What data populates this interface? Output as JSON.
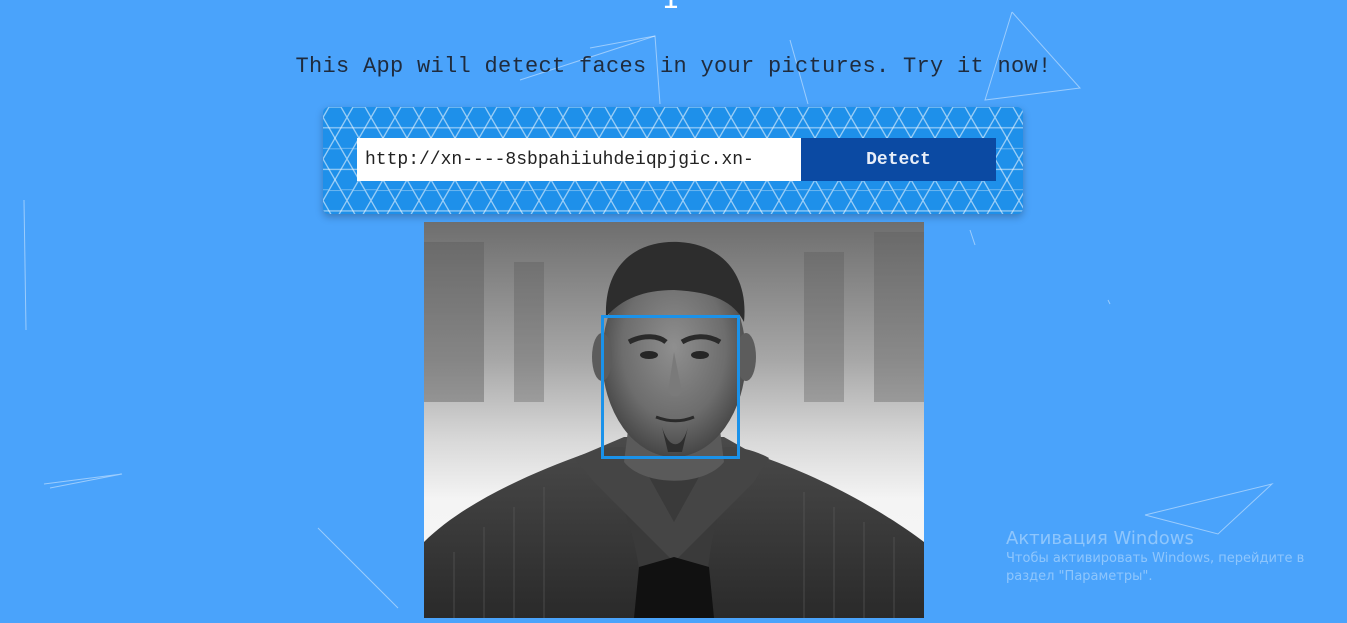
{
  "header": {
    "top_glyph": "I",
    "tagline": "This App will detect faces in your pictures. Try it now!"
  },
  "search": {
    "url_value": "http://xn----8sbpahiiuhdeiqpjgic.xn-",
    "detect_label": "Detect"
  },
  "result": {
    "faces_detected": 1
  },
  "watermark": {
    "title": "Активация Windows",
    "line1": "Чтобы активировать Windows, перейдите в",
    "line2": "раздел \"Параметры\"."
  },
  "colors": {
    "background": "#4aa3fb",
    "panel": "#1e90ea",
    "button": "#0b4aa3",
    "face_box": "#1a92ea"
  }
}
